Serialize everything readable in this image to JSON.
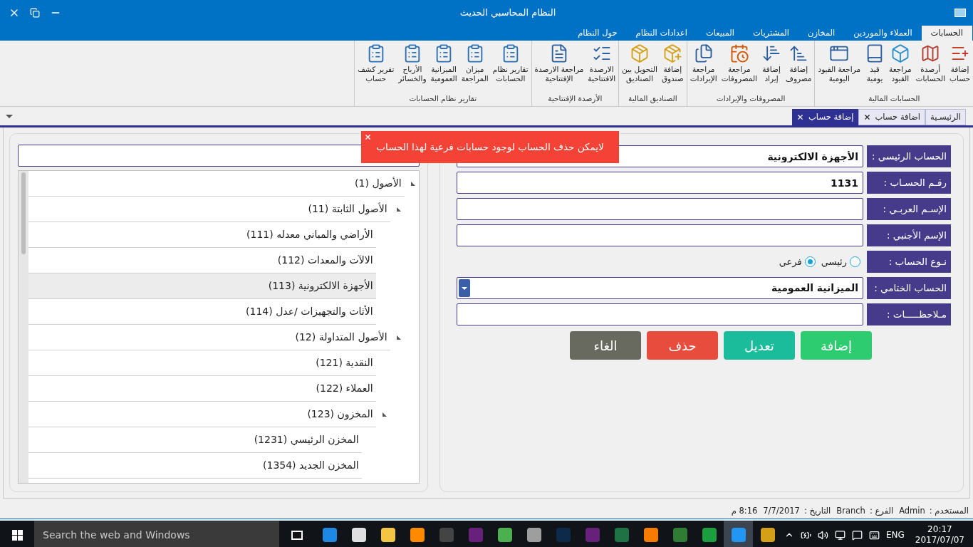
{
  "window": {
    "title": "النظام المحاسبي الحديث"
  },
  "menu_tabs": [
    {
      "label": "الحسابات",
      "selected": true
    },
    {
      "label": "العملاء والموردين",
      "selected": false
    },
    {
      "label": "المخازن",
      "selected": false
    },
    {
      "label": "المشتريات",
      "selected": false
    },
    {
      "label": "المبيعات",
      "selected": false
    },
    {
      "label": "اعدادات النظام",
      "selected": false
    },
    {
      "label": "حول النظام",
      "selected": false
    }
  ],
  "ribbon_groups": [
    {
      "title": "الحسابات المالية",
      "items": [
        {
          "label": "إضافة\nحساب",
          "kind": "add-list"
        },
        {
          "label": "أرصدة\nالحسابات",
          "kind": "map"
        },
        {
          "label": "مراجعة\nالقيود",
          "kind": "cube"
        },
        {
          "label": "قيد\nيومية",
          "kind": "book"
        },
        {
          "label": "مراجعة القيود\nاليومية",
          "kind": "window"
        }
      ]
    },
    {
      "title": "المصروفات والإيرادات",
      "items": [
        {
          "label": "إضافة\nمصروف",
          "kind": "up"
        },
        {
          "label": "إضافة\nإيراد",
          "kind": "down"
        },
        {
          "label": "مراجعة\nالمصروفات",
          "kind": "clock"
        },
        {
          "label": "مراجعة\nالإيرادات",
          "kind": "docs"
        }
      ]
    },
    {
      "title": "الصناديق المالية",
      "items": [
        {
          "label": "إضافة\nصندوق",
          "kind": "box-gear"
        },
        {
          "label": "التحويل بين\nالصناديق",
          "kind": "boxes"
        }
      ]
    },
    {
      "title": "الأرصدة الإفتتاحية",
      "items": [
        {
          "label": "الارصدة\nالافتتاحية",
          "kind": "list"
        },
        {
          "label": "مراجعة الارصدة\nالإفتتاحية",
          "kind": "doc"
        }
      ]
    },
    {
      "title": "تقارير نظام الحسابات",
      "items": [
        {
          "label": "تقارير نظام\nالحسابات",
          "kind": "clipboard"
        },
        {
          "label": "ميزان\nالمراجعة",
          "kind": "clipboard"
        },
        {
          "label": "الميزانية\nالعمومية",
          "kind": "clipboard"
        },
        {
          "label": "الأرباح\nوالخسائر",
          "kind": "clipboard"
        },
        {
          "label": "تقرير كشف\nحساب",
          "kind": "clipboard"
        }
      ]
    }
  ],
  "doc_tabs": [
    {
      "label": "الرئيسـية",
      "selected": false,
      "closable": false
    },
    {
      "label": "اضافة حساب",
      "selected": false,
      "closable": true
    },
    {
      "label": "إضافة حساب",
      "selected": true,
      "closable": true
    }
  ],
  "form": {
    "fields": [
      {
        "kind": "text",
        "label": "الحساب الرئيسي :",
        "value": "الأجهزة الالكترونية"
      },
      {
        "kind": "text",
        "label": "رقـم الحسـاب :",
        "value": "1131"
      },
      {
        "kind": "text",
        "label": "الإسـم العربـي :"
      },
      {
        "kind": "text",
        "label": "الإسم الأجنبي :"
      },
      {
        "kind": "radio",
        "label": "نـوع الحساب :",
        "options": [
          {
            "label": "رئيسي",
            "selected": false
          },
          {
            "label": "فرعي",
            "selected": true
          }
        ]
      },
      {
        "kind": "select",
        "label": "الحساب الختامي :",
        "value": "الميزانية العمومية"
      },
      {
        "kind": "text",
        "label": "مـلاحظـــــات :"
      }
    ],
    "buttons": [
      {
        "label": "إضافة",
        "color": "#2ecc71"
      },
      {
        "label": "تعديل",
        "color": "#1abc9c"
      },
      {
        "label": "حذف",
        "color": "#e74c3c"
      },
      {
        "label": "الغاء",
        "color": "#686a5f"
      }
    ]
  },
  "toast": {
    "message": "لايمكن حذف الحساب لوجود حسابات فرعية لهذا الحساب"
  },
  "tree": [
    {
      "label": "الأصول (1)",
      "selected": false,
      "expanded": true,
      "children": [
        {
          "label": "الأصول الثابتة (11)",
          "selected": false,
          "expanded": true,
          "children": [
            {
              "label": "الأراضي والمباني معدله (111)",
              "selected": false
            },
            {
              "label": "الالآت والمعدات (112)",
              "selected": false
            },
            {
              "label": "الأجهزة الالكترونية (113)",
              "selected": true
            },
            {
              "label": "الأثاث والتجهيزات /عدل (114)",
              "selected": false
            }
          ]
        },
        {
          "label": "الأصول المتداولة (12)",
          "selected": false,
          "expanded": true,
          "children": [
            {
              "label": "النقدية (121)",
              "selected": false
            },
            {
              "label": "العملاء (122)",
              "selected": false
            },
            {
              "label": "المخزون (123)",
              "selected": false,
              "expanded": true,
              "children": [
                {
                  "label": "المخزن الرئيسي (1231)",
                  "selected": false
                },
                {
                  "label": "المخزن الجديد (1354)",
                  "selected": false
                }
              ]
            }
          ]
        }
      ]
    }
  ],
  "status_bar": [
    {
      "label": "المستخدم :",
      "value": "Admin"
    },
    {
      "label": "الفرع :",
      "value": "Branch"
    },
    {
      "label": "التاريخ :",
      "value": "7/7/2017"
    },
    {
      "value": "8:16 م"
    }
  ],
  "taskbar": {
    "search_placeholder": "Search the web and Windows",
    "apps": [
      {
        "color": "#1e88e5",
        "active": false
      },
      {
        "color": "#e0e0e0",
        "active": false
      },
      {
        "color": "#f4c542",
        "active": false
      },
      {
        "color": "#ff8a00",
        "active": false
      },
      {
        "color": "#444444",
        "active": false
      },
      {
        "color": "#68217a",
        "active": false
      },
      {
        "color": "#4caf50",
        "active": false
      },
      {
        "color": "#9e9e9e",
        "active": false
      },
      {
        "color": "#0d2a4a",
        "active": false
      },
      {
        "color": "#68217a",
        "active": false
      },
      {
        "color": "#1f7244",
        "active": false
      },
      {
        "color": "#f57c00",
        "active": false
      },
      {
        "color": "#2e7d32",
        "active": false
      },
      {
        "color": "#1b9e3e",
        "active": false
      },
      {
        "color": "#2196f3",
        "active": true
      },
      {
        "color": "#d4a017",
        "active": false
      }
    ],
    "language": "ENG",
    "time": "20:17",
    "date": "2017/07/07"
  }
}
